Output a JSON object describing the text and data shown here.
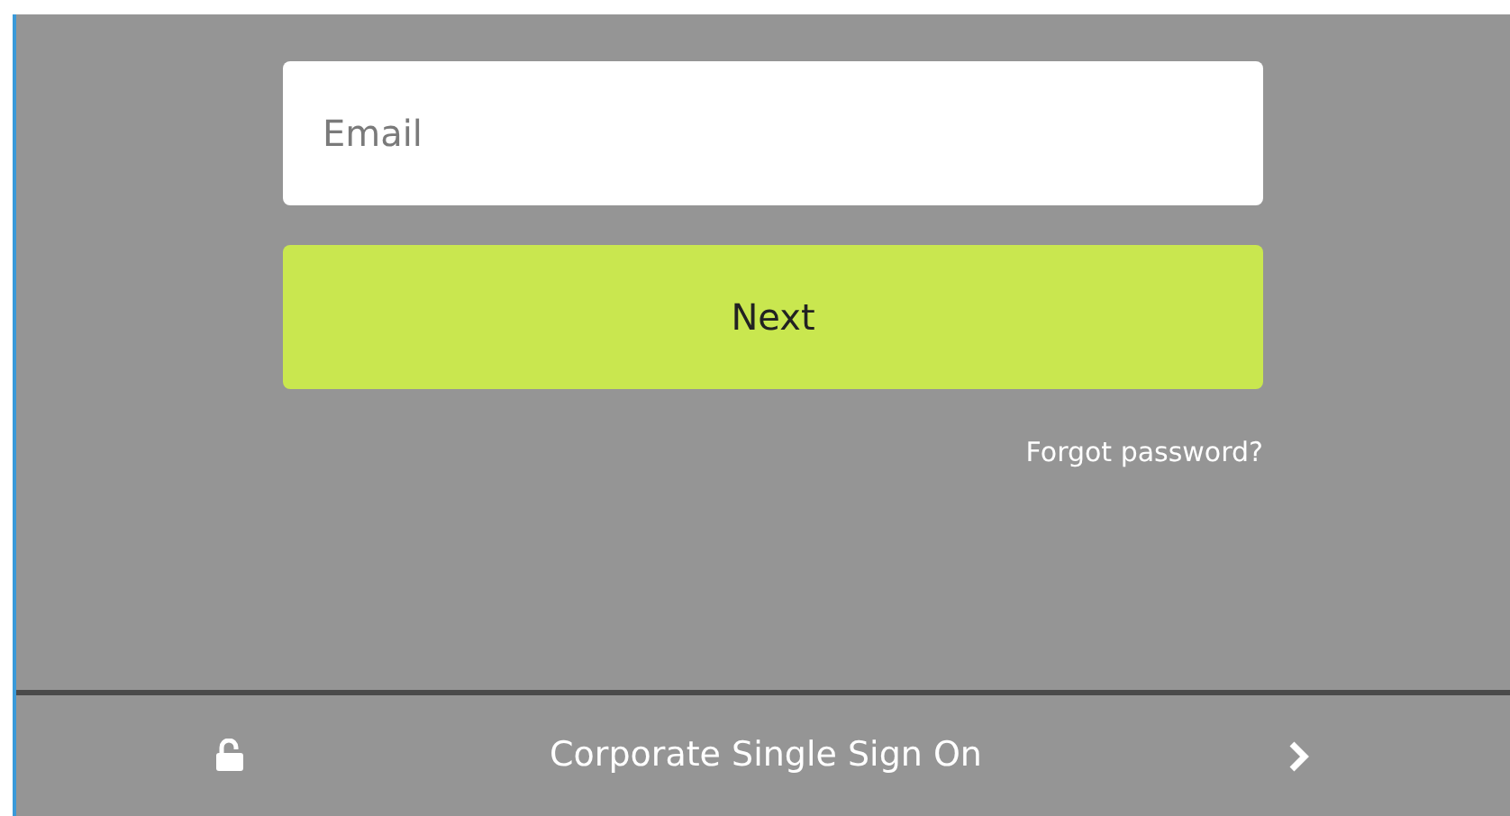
{
  "email": {
    "placeholder": "Email"
  },
  "next_button": "Next",
  "forgot_link": "Forgot password?",
  "sso": {
    "label": "Corporate Single Sign On"
  }
}
